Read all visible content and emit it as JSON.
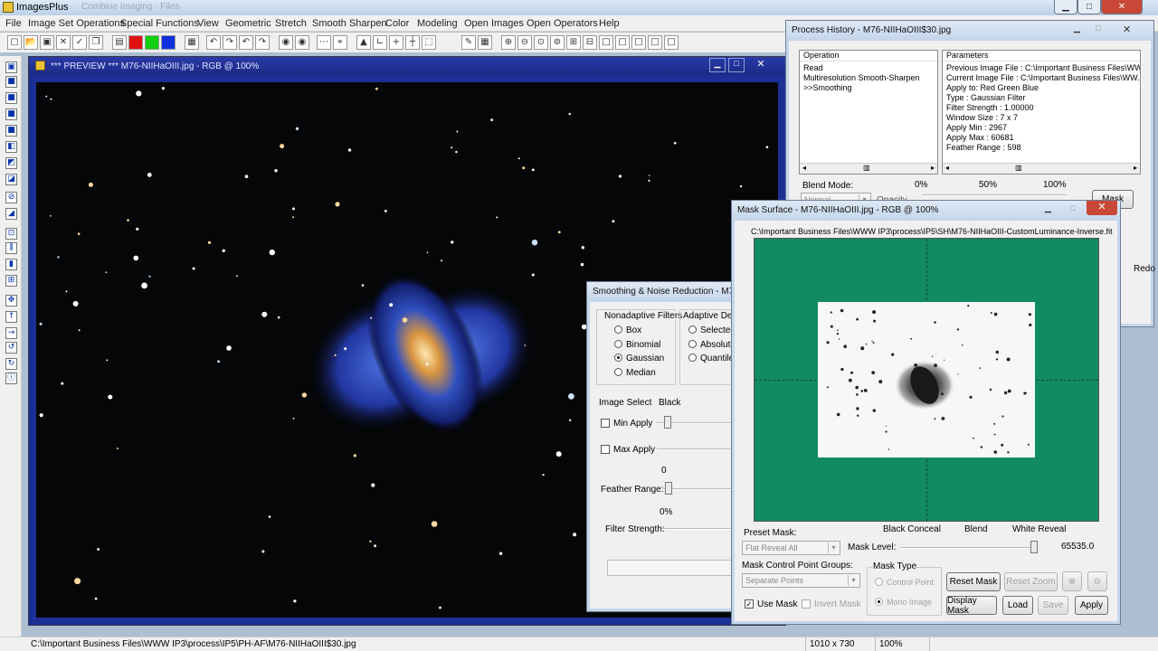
{
  "app": {
    "title": "ImagesPlus",
    "ghost_text": "Combine Imaging   ·   Files"
  },
  "menu": [
    "File",
    "Image Set Operations",
    "Special Functions",
    "View",
    "Geometric",
    "Stretch",
    "Smooth Sharpen",
    "Color",
    "Modeling",
    "Open Images",
    "Open Operators",
    "Help"
  ],
  "toolbar_icons": [
    "new-icon",
    "open-icon",
    "save-icon",
    "close-icon",
    "check-icon",
    "copy-icon",
    "rgb-channels-icon",
    "red-icon",
    "green-icon",
    "blue-icon",
    "grid-icon",
    "undo-icon",
    "redo-icon",
    "undo-all-icon",
    "redo-all-icon",
    "target-icon",
    "record-icon",
    "dots-icon",
    "crosshair-icon",
    "triangle-icon",
    "axes-icon",
    "plus-icon",
    "cross-icon",
    "dotted-box-icon",
    "pencil-icon",
    "grid2-icon",
    "zoom-in-icon",
    "zoom-out-icon",
    "zoom-fit-icon",
    "zoom-100-icon",
    "add-icon",
    "minus-icon",
    "box1-icon",
    "box2-icon",
    "box3-icon",
    "box4-icon",
    "box5-icon"
  ],
  "preview": {
    "title": "*** PREVIEW *** M76-NIIHaOIII.jpg - RGB @ 100%"
  },
  "history": {
    "title": "Process History - M76-NIIHaOIII$30.jpg",
    "col_operation": "Operation",
    "col_parameters": "Parameters",
    "operations": [
      "Read",
      "Multiresolution Smooth-Sharpen",
      ">>Smoothing"
    ],
    "parameters": [
      "Previous Image File : C:\\Important Business Files\\WW...",
      "Current Image File : C:\\Important Business Files\\WW...",
      "Apply to:  Red Green Blue",
      "Type : Gaussian Filter",
      "Filter Strength : 1.00000",
      "Window Size : 7 x 7",
      "Apply Min : 2967",
      "Apply Max : 60681",
      "Feather Range : 598"
    ],
    "blend_mode": "Blend Mode:",
    "pct0": "0%",
    "pct50": "50%",
    "pct100": "100%",
    "mask_btn": "Mask",
    "redo": "Redo",
    "normal": "Normal",
    "opacity": "Opacity"
  },
  "smooth": {
    "title": "Smoothing & Noise Reduction - M7",
    "nonadaptive": "Nonadaptive Filters",
    "filters": [
      "Box",
      "Binomial",
      "Gaussian",
      "Median"
    ],
    "selected_filter": "Gaussian",
    "adaptive": "Adaptive Det",
    "adaptive_opts": [
      "Selected",
      "Absolute",
      "Quantile"
    ],
    "image_select": "Image Select",
    "black": "Black",
    "min_apply": "Min Apply",
    "max_apply": "Max Apply",
    "zero": "0",
    "feather_range": "Feather Range:",
    "zero_pct": "0%",
    "filter_strength": "Filter Strength:"
  },
  "mask": {
    "title": "Mask Surface - M76-NIIHaOIII.jpg - RGB @ 100%",
    "path": "C:\\Important Business Files\\WWW IP3\\process\\IP5\\SH\\M76-NIIHaOIII-CustomLuminance-Inverse.fit",
    "black_conceal": "Black Conceal",
    "blend": "Blend",
    "white_reveal": "White Reveal",
    "preset_mask": "Preset Mask:",
    "preset_value": "Flat Reveal All",
    "mask_level": "Mask Level:",
    "mask_level_value": "65535.0",
    "cp_groups": "Mask Control Point Groups:",
    "cp_value": "Separate Points",
    "mask_type": "Mask Type",
    "control_point": "Control Point",
    "mono_image": "Mono Image",
    "use_mask": "Use Mask",
    "invert_mask": "Invert Mask",
    "reset_mask": "Reset Mask",
    "reset_zoom": "Reset Zoom",
    "display_mask": "Display Mask",
    "load": "Load",
    "save": "Save",
    "apply": "Apply",
    "bg_color": "#128a64"
  },
  "status": {
    "path": "C:\\Important Business Files\\WWW IP3\\process\\IP5\\PH-AF\\M76-NIIHaOIII$30.jpg",
    "dims": "1010 x 730",
    "zoom": "100%"
  }
}
